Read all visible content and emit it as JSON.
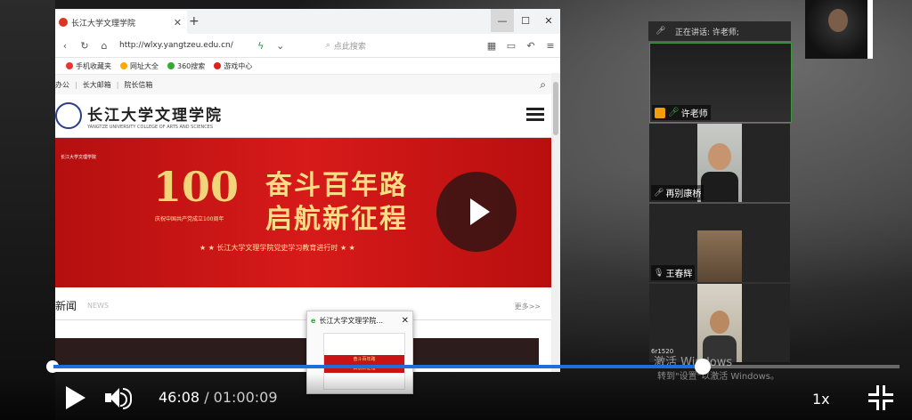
{
  "browser": {
    "tab_title": "长江大学文理学院",
    "new_tab": "+",
    "url": "http://wlxy.yangtzeu.edu.cn/",
    "search_placeholder": "点此搜索",
    "bookmarks": [
      "手机收藏夹",
      "网址大全",
      "360搜索",
      "游戏中心"
    ]
  },
  "site": {
    "top_links": [
      "办公",
      "长大邮箱",
      "院长信箱"
    ],
    "logo_cn": "长江大学文理学院",
    "logo_en": "YANGTZE UNIVERSITY COLLEGE OF ARTS AND SCIENCES",
    "banner_corner": "长江大学文理学院",
    "banner_number": "100",
    "banner_caption": "庆祝中国共产党成立100周年",
    "banner_line1": "奋斗百年路",
    "banner_line2": "启航新征程",
    "banner_sub": "★ ★ 长江大学文理学院党史学习教育进行时 ★ ★",
    "news_title": "新闻",
    "news_en": "NEWS",
    "news_more": "更多>>"
  },
  "thumbnail": {
    "title": "长江大学文理学院...",
    "preview_lines": [
      "奋斗百年路",
      "启航新征程"
    ]
  },
  "meeting": {
    "speaking": "正在讲话: 许老师;",
    "participants": [
      {
        "name": "许老师"
      },
      {
        "name": "再别康桥"
      },
      {
        "name": "王春辉"
      },
      {
        "name": ""
      }
    ],
    "tile4_tag": "6r1520"
  },
  "watermark": {
    "line1": "激活 Windows",
    "line2": "转到\"设置\"以激活 Windows。"
  },
  "player": {
    "current_time": "46:08",
    "separator": " / ",
    "total_time": "01:00:09",
    "progress": 0.767,
    "speed": "1x",
    "accent": "#1e6fd9"
  }
}
